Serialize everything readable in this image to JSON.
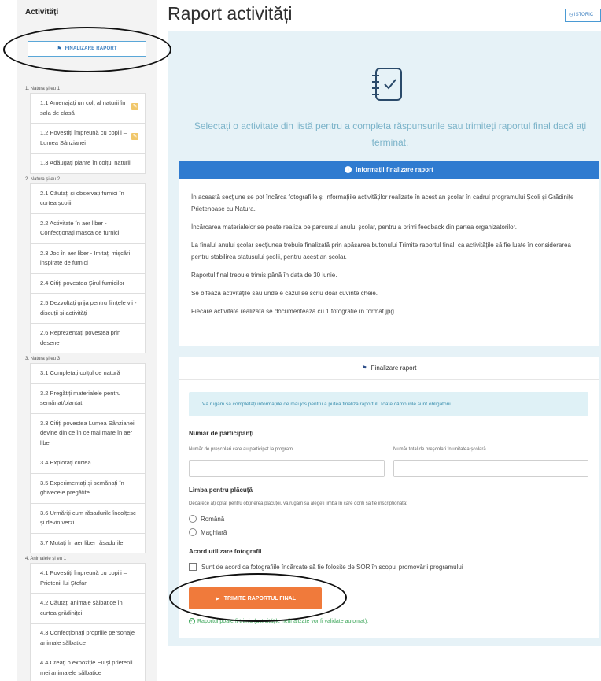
{
  "sidebar": {
    "title": "Activități",
    "finalize_label": "FINALIZARE RAPORT",
    "sections": [
      {
        "header": "1. Natura și eu 1",
        "items": [
          {
            "label": "1.1 Amenajați un colț al naturii în sala de clasă",
            "edited": true
          },
          {
            "label": "1.2 Povestiți împreună cu copiii – Lumea Sânzianei",
            "edited": true
          },
          {
            "label": "1.3 Adăugați plante în colțul naturii",
            "edited": false
          }
        ]
      },
      {
        "header": "2. Natura și eu 2",
        "items": [
          {
            "label": "2.1 Căutați și observați furnici în curtea școlii",
            "edited": false
          },
          {
            "label": "2.2 Activitate în aer liber - Confecționați masca de furnici",
            "edited": false
          },
          {
            "label": "2.3 Joc în aer liber - Imitați mișcări inspirate de furnici",
            "edited": false
          },
          {
            "label": "2.4 Citiți povestea Șirul furnicilor",
            "edited": false
          },
          {
            "label": "2.5 Dezvoltați grija pentru ființele vii - discuții și activități",
            "edited": false
          },
          {
            "label": "2.6 Reprezentați povestea prin desene",
            "edited": false
          }
        ]
      },
      {
        "header": "3. Natura și eu 3",
        "items": [
          {
            "label": "3.1 Completați colțul de natură",
            "edited": false
          },
          {
            "label": "3.2 Pregătiți materialele pentru semănat/plantat",
            "edited": false
          },
          {
            "label": "3.3 Citiți povestea Lumea Sânzianei devine din ce în ce mai mare în aer liber",
            "edited": false
          },
          {
            "label": "3.4 Explorați curtea",
            "edited": false
          },
          {
            "label": "3.5 Experimentați și semănați în ghivecele pregătite",
            "edited": false
          },
          {
            "label": "3.6 Urmăriți cum răsadurile încolțesc și devin verzi",
            "edited": false
          },
          {
            "label": "3.7 Mutați în aer liber răsadurile",
            "edited": false
          }
        ]
      },
      {
        "header": "4. Animalele și eu 1",
        "items": [
          {
            "label": "4.1 Povestiți împreună cu copiii – Prietenii lui Ștefan",
            "edited": false
          },
          {
            "label": "4.2 Căutați animale sălbatice în curtea grădiniței",
            "edited": false
          },
          {
            "label": "4.3 Confecționați propriile personaje animale sălbatice",
            "edited": false
          },
          {
            "label": "4.4 Creați o expoziție Eu și prietenii mei animalele sălbatice",
            "edited": false
          }
        ]
      }
    ]
  },
  "header": {
    "title": "Raport activități",
    "history_label": "ISTORIC"
  },
  "intro_text": "Selectați o activitate din listă pentru a completa răspunsurile sau trimiteți raportul final dacă ați terminat.",
  "info": {
    "title": "Informații finalizare raport",
    "paragraphs": [
      "În această secțiune se pot încărca fotografiile și informațiile activităților realizate în acest an școlar în cadrul programului Școli și Grădinițe Prietenoase cu Natura.",
      "Încărcarea materialelor se poate realiza pe parcursul anului școlar, pentru a primi feedback din partea organizatorilor.",
      "La finalul anului școlar secțiunea trebuie finalizată prin apăsarea butonului Trimite raportul final, ca activitățile să fie luate în considerarea pentru stabilirea statusului școlii, pentru acest an școlar.",
      "Raportul final trebuie trimis până în data de 30 iunie.",
      "Se bifează activitățile sau unde e cazul se scriu doar cuvinte cheie.",
      "Fiecare activitate realizată se documentează cu 1 fotografie în format jpg."
    ]
  },
  "finalize": {
    "title": "Finalizare raport",
    "alert": "Vă rugăm să completați informațiile de mai jos pentru a putea finaliza raportul. Toate câmpurile sunt obligatorii.",
    "participants_title": "Număr de participanți",
    "participants_label": "Număr de preșcolari care au participat la program",
    "total_label": "Număr total de preșcolari în unitatea școlară",
    "participants_value": "",
    "total_value": "",
    "language_title": "Limba pentru plăcuță",
    "language_desc": "Deoarece ați optat pentru obținerea plăcuței, vă rugăm să alegeți limba în care doriți să fie inscripționată:",
    "language_options": [
      "Română",
      "Maghiară"
    ],
    "photos_title": "Acord utilizare fotografii",
    "photos_consent": "Sunt de acord ca fotografiile încărcate să fie folosite de SOR în scopul promovării programului",
    "submit_label": "TRIMITE RAPORTUL FINAL",
    "status_text": "Raportul poate fi trimis (activitățile nefinalizate vor fi validate automat)."
  },
  "colors": {
    "accent_blue": "#2f7bd0",
    "submit_orange": "#f07a3b",
    "status_green": "#3da65a",
    "panel_bg": "#e6f2f7"
  }
}
